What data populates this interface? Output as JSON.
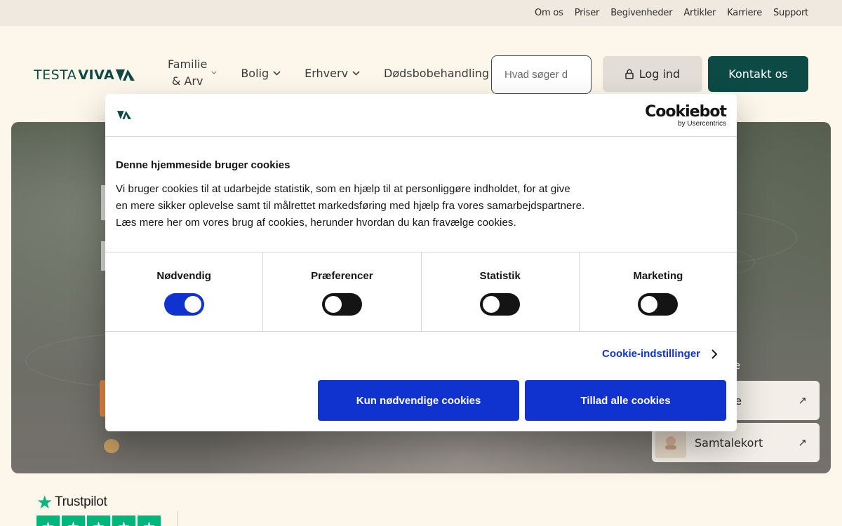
{
  "topbar": {
    "links": [
      "Om os",
      "Priser",
      "Begivenheder",
      "Artikler",
      "Karriere",
      "Support"
    ]
  },
  "header": {
    "logo_thin": "TESTA",
    "logo_bold": "VIVA",
    "nav": {
      "familie_line1": "Familie",
      "familie_line2": "& Arv",
      "bolig": "Bolig",
      "erhverv": "Erhverv",
      "doedsbo": "Dødsbobehandling"
    },
    "search_placeholder": "Hvad søger d",
    "login_label": "Log ind",
    "contact_label": "Kontakt os"
  },
  "hero": {
    "side_cards": [
      {
        "label": "ente",
        "arrow": "↗"
      },
      {
        "label": "Samtalekort",
        "arrow": "↗"
      }
    ],
    "partial_right": "re"
  },
  "trustpilot": {
    "brand": "Trustpilot",
    "star_glyph": "★"
  },
  "cookie_dialog": {
    "brand_name": "Cookiebot",
    "brand_by": "by Usercentrics",
    "title": "Denne hjemmeside bruger cookies",
    "text_line1": "Vi bruger cookies til at udarbejde statistik, som en hjælp til at personliggøre indholdet, for at give",
    "text_line2": "en mere sikker oplevelse samt til målrettet markedsføring med hjælp fra vores samarbejdspartnere.",
    "text_line3": "Læs mere her om vores brug af cookies, herunder hvordan du kan fravælge cookies.",
    "toggles": [
      {
        "label": "Nødvendig",
        "on": true
      },
      {
        "label": "Præferencer",
        "on": false
      },
      {
        "label": "Statistik",
        "on": false
      },
      {
        "label": "Marketing",
        "on": false
      }
    ],
    "settings_label": "Cookie-indstillinger",
    "btn_necessary": "Kun nødvendige cookies",
    "btn_all": "Tillad alle cookies"
  },
  "colors": {
    "brand_green": "#0d4a45",
    "cookiebot_blue": "#1032cf",
    "trustpilot_green": "#00b67a"
  }
}
